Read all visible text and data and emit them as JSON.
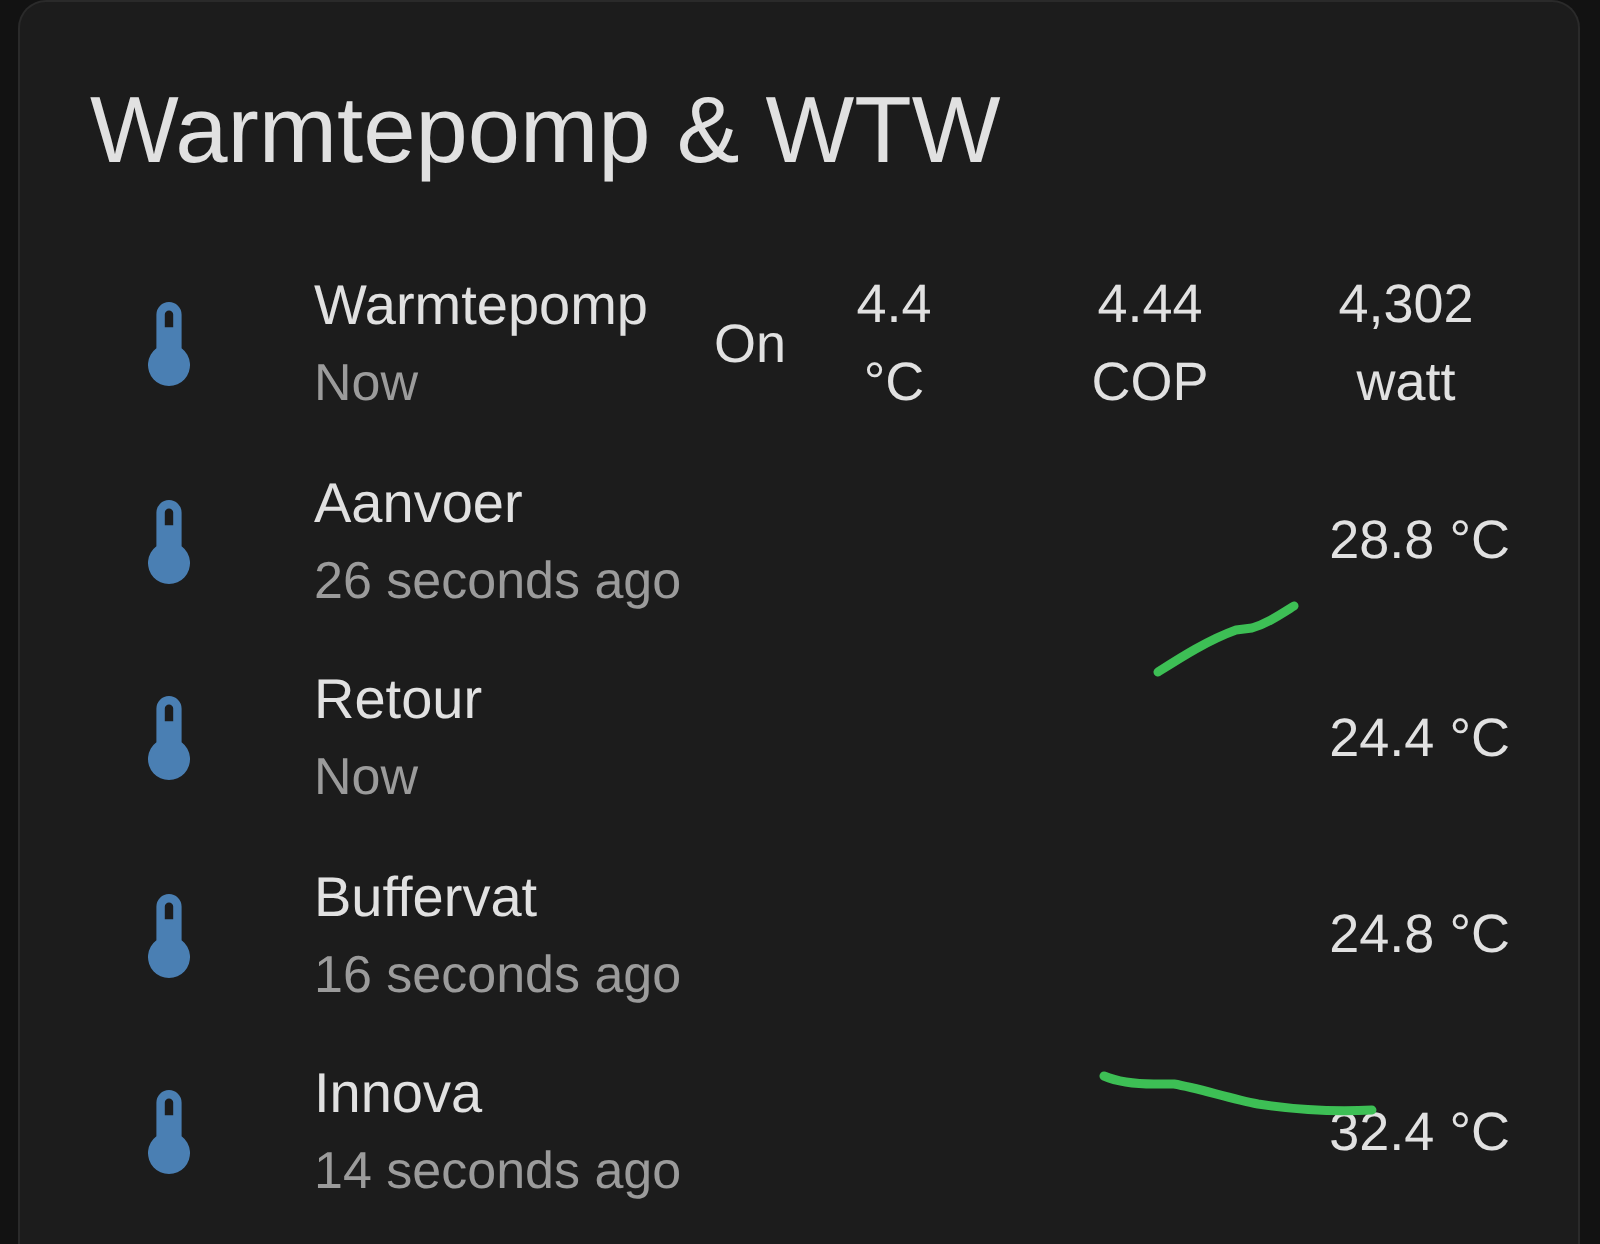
{
  "card": {
    "title": "Warmtepomp & WTW"
  },
  "entities": [
    {
      "kind": "multi",
      "name": "Warmtepomp",
      "secondary": "Now",
      "state": "On",
      "attributes": [
        {
          "value": "4.4",
          "unit": "°C"
        },
        {
          "value": "4.44",
          "unit": "COP"
        },
        {
          "value": "4,302",
          "unit": "watt"
        }
      ]
    },
    {
      "kind": "sensor",
      "name": "Aanvoer",
      "secondary": "26 seconds ago",
      "value": "28.8 °C",
      "stroke": {
        "kind": "rising"
      }
    },
    {
      "kind": "sensor",
      "name": "Retour",
      "secondary": "Now",
      "value": "24.4 °C"
    },
    {
      "kind": "sensor",
      "name": "Buffervat",
      "secondary": "16 seconds ago",
      "value": "24.8 °C"
    },
    {
      "kind": "sensor",
      "name": "Innova",
      "secondary": "14 seconds ago",
      "value": "32.4 °C",
      "stroke": {
        "kind": "falling"
      }
    }
  ]
}
